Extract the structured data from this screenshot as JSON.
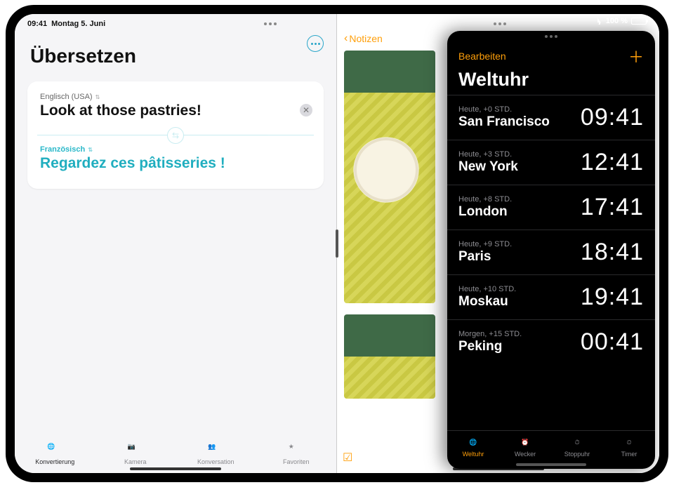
{
  "status": {
    "time": "09:41",
    "date": "Montag 5. Juni",
    "battery_pct": "100 %"
  },
  "translate": {
    "title": "Übersetzen",
    "src_lang": "Englisch (USA)",
    "src_text": "Look at those pastries!",
    "dst_lang": "Französisch",
    "dst_text": "Regardez ces pâtisseries !",
    "tabs": [
      {
        "label": "Konvertierung"
      },
      {
        "label": "Kamera"
      },
      {
        "label": "Konversation"
      },
      {
        "label": "Favoriten"
      }
    ]
  },
  "notes": {
    "back_label": "Notizen"
  },
  "clock": {
    "edit": "Bearbeiten",
    "title": "Weltuhr",
    "cities": [
      {
        "meta": "Heute, +0 STD.",
        "city": "San Francisco",
        "time": "09:41"
      },
      {
        "meta": "Heute, +3 STD.",
        "city": "New York",
        "time": "12:41"
      },
      {
        "meta": "Heute, +8 STD.",
        "city": "London",
        "time": "17:41"
      },
      {
        "meta": "Heute, +9 STD.",
        "city": "Paris",
        "time": "18:41"
      },
      {
        "meta": "Heute, +10 STD.",
        "city": "Moskau",
        "time": "19:41"
      },
      {
        "meta": "Morgen, +15 STD.",
        "city": "Peking",
        "time": "00:41"
      }
    ],
    "tabs": [
      {
        "label": "Weltuhr"
      },
      {
        "label": "Wecker"
      },
      {
        "label": "Stoppuhr"
      },
      {
        "label": "Timer"
      }
    ]
  }
}
